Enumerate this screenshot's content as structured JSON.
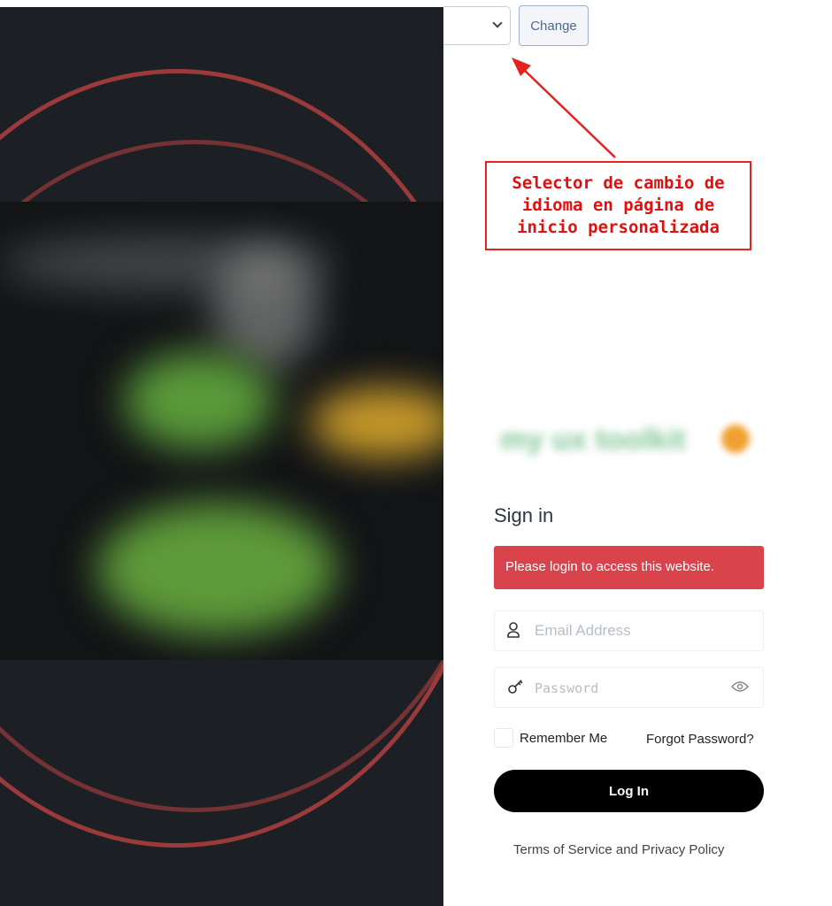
{
  "language": {
    "selected": "",
    "change_label": "Change"
  },
  "annotation": {
    "text_lines": [
      "Selector de cambio de",
      "idioma en página de",
      "inicio personalizada"
    ],
    "color": "#e01010"
  },
  "login": {
    "title": "Sign in",
    "alert": "Please login to access this website.",
    "email_placeholder": "Email Address",
    "password_placeholder": "Password",
    "remember_label": "Remember Me",
    "forgot_label": "Forgot Password?",
    "submit_label": "Log In",
    "terms_label": "Terms of Service and Privacy Policy",
    "alert_color": "#d9434b"
  },
  "icons": {
    "email": "user-icon",
    "password": "key-icon",
    "toggle": "eye-icon",
    "select": "chevron-down-icon"
  }
}
